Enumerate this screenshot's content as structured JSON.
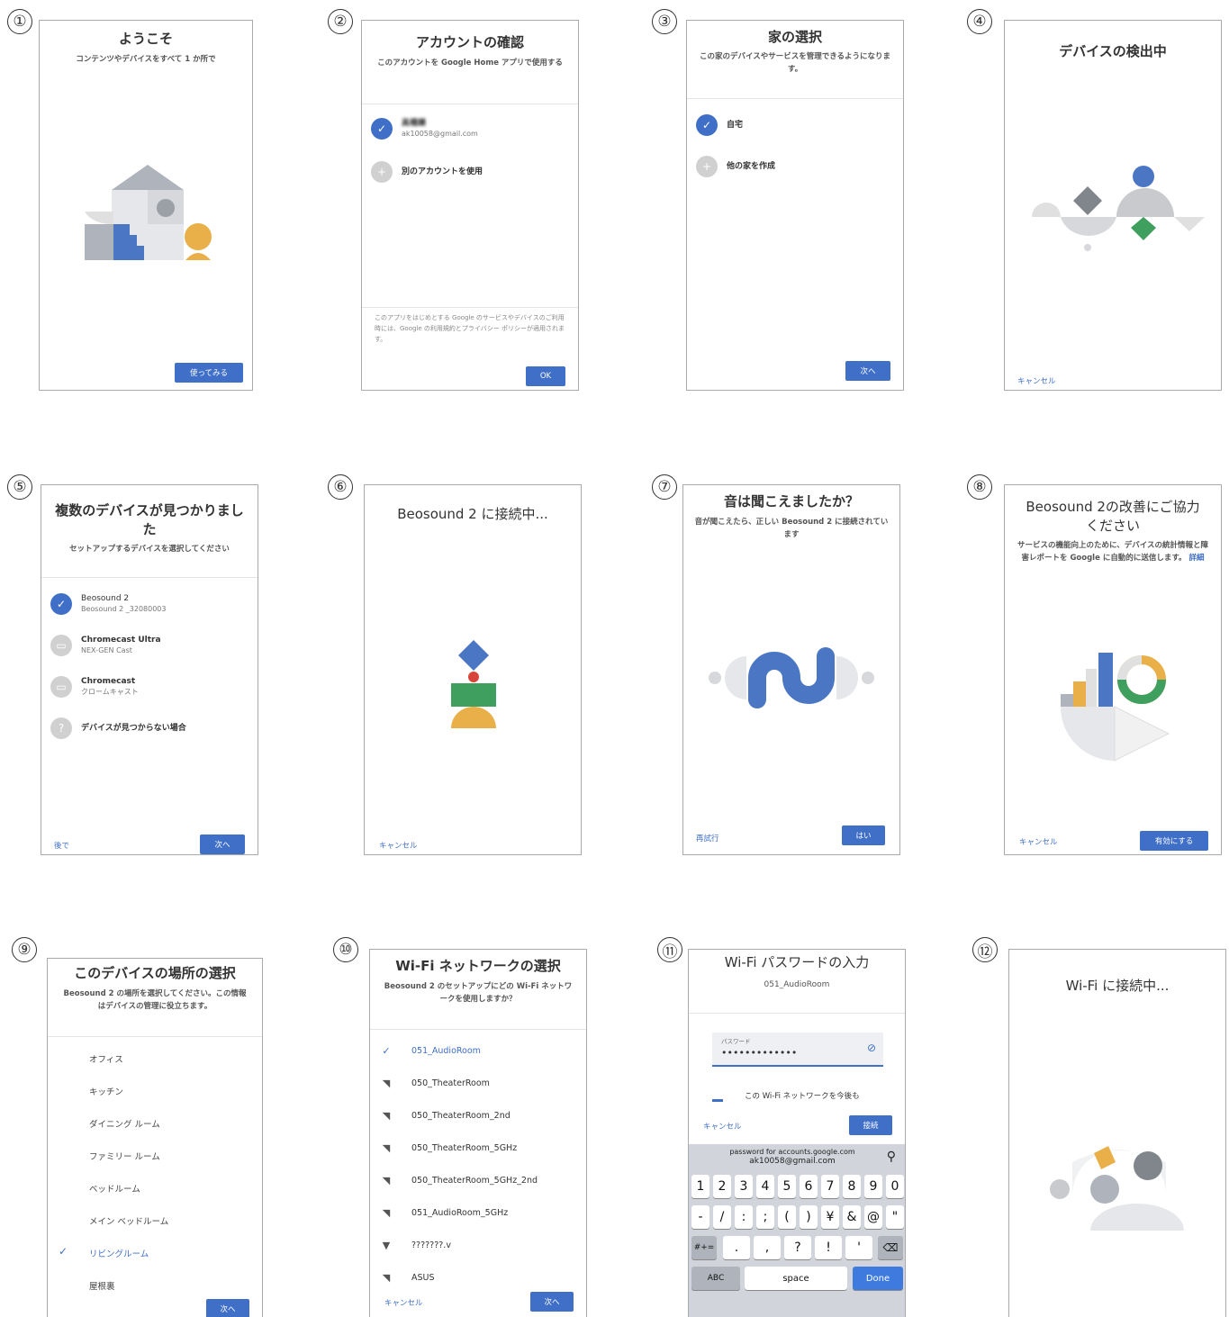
{
  "steps": [
    "①",
    "②",
    "③",
    "④",
    "⑤",
    "⑥",
    "⑦",
    "⑧",
    "⑨",
    "⑩",
    "⑪",
    "⑫"
  ],
  "s1": {
    "title": "ようこそ",
    "subtitle": "コンテンツやデバイスをすべて 1 か所で",
    "button": "使ってみる"
  },
  "s2": {
    "title": "アカウントの確認",
    "subtitle": "このアカウントを Google Home アプリで使用する",
    "account_name": "高橋謙",
    "account_email": "ak10058@gmail.com",
    "other_account": "別のアカウントを使用",
    "footer": "このアプリをはじめとする Google のサービスやデバイスのご利用時には、Google の利用規約とプライバシー ポリシーが適用されます。",
    "button": "OK"
  },
  "s3": {
    "title": "家の選択",
    "subtitle": "この家のデバイスやサービスを管理できるようになります。",
    "home": "自宅",
    "create": "他の家を作成",
    "button": "次へ"
  },
  "s4": {
    "title": "デバイスの検出中",
    "cancel": "キャンセル"
  },
  "s5": {
    "title": "複数のデバイスが見つかりました",
    "subtitle": "セットアップするデバイスを選択してください",
    "devices": [
      {
        "name": "Beosound 2",
        "detail": "Beosound 2 _32080003"
      },
      {
        "name": "Chromecast Ultra",
        "detail": "NEX-GEN Cast"
      },
      {
        "name": "Chromecast",
        "detail": "クロームキャスト"
      },
      {
        "name": "デバイスが見つからない場合",
        "detail": ""
      }
    ],
    "later": "後で",
    "button": "次へ"
  },
  "s6": {
    "title": "Beosound 2 に接続中...",
    "cancel": "キャンセル"
  },
  "s7": {
    "title": "音は聞こえましたか？",
    "subtitle": "音が聞こえたら、正しい Beosound 2 に接続されています",
    "retry": "再試行",
    "button": "はい"
  },
  "s8": {
    "title": "Beosound 2の改善にご協力ください",
    "subtitle": "サービスの機能向上のために、デバイスの統計情報と障害レポートを Google に自動的に送信します。",
    "more": "詳細",
    "cancel": "キャンセル",
    "button": "有効にする"
  },
  "s9": {
    "title": "このデバイスの場所の選択",
    "subtitle": "Beosound 2 の場所を選択してください。この情報はデバイスの管理に役立ちます。",
    "rooms": [
      "オフィス",
      "キッチン",
      "ダイニング ルーム",
      "ファミリー ルーム",
      "ベッドルーム",
      "メイン ベッドルーム",
      "リビングルーム",
      "屋根裏"
    ],
    "selected_room": "リビングルーム",
    "button": "次へ"
  },
  "s10": {
    "title": "Wi-Fi ネットワークの選択",
    "subtitle": "Beosound 2 のセットアップにどの Wi-Fi ネットワークを使用しますか？",
    "networks": [
      "051_AudioRoom",
      "050_TheaterRoom",
      "050_TheaterRoom_2nd",
      "050_TheaterRoom_5GHz",
      "050_TheaterRoom_5GHz_2nd",
      "051_AudioRoom_5GHz",
      "???????.v",
      "ASUS"
    ],
    "cancel": "キャンセル",
    "button": "次へ"
  },
  "s11": {
    "title": "Wi-Fi パスワードの入力",
    "network": "051_AudioRoom",
    "field_label": "パスワード",
    "password": "•••••••••••••",
    "remember": "この Wi-Fi ネットワークを今後も",
    "cancel": "キャンセル",
    "button": "接続",
    "suggest_1": "password for accounts.google.com",
    "suggest_2": "ak10058@gmail.com",
    "row1": [
      "1",
      "2",
      "3",
      "4",
      "5",
      "6",
      "7",
      "8",
      "9",
      "0"
    ],
    "row2": [
      "-",
      "/",
      ":",
      ";",
      "(",
      ")",
      "¥",
      "&",
      "@",
      "\""
    ],
    "row3": [
      ".",
      ",",
      "?",
      "!",
      "'"
    ],
    "sym": "#+=",
    "abc": "ABC",
    "space": "space",
    "done": "Done"
  },
  "s12": {
    "title": "Wi-Fi に接続中..."
  }
}
